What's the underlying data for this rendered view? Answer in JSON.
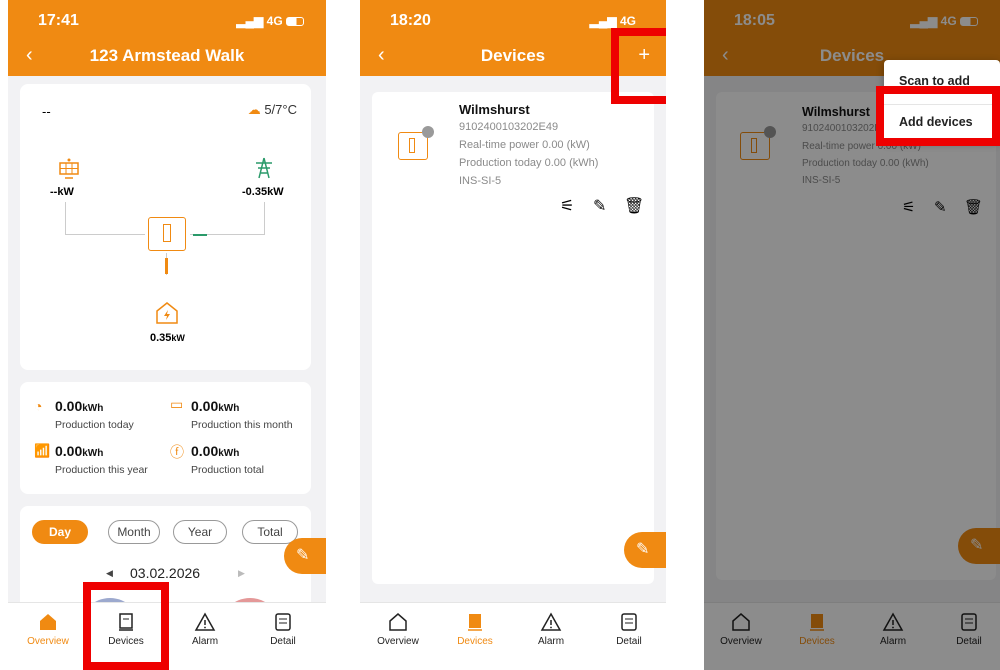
{
  "colors": {
    "accent": "#f08a12",
    "highlight": "#ee0000"
  },
  "screen1": {
    "time": "17:41",
    "signal": "4G",
    "title": "123 Armstead Walk",
    "weather_left": "--",
    "weather_right": "5/7°C",
    "pv_power": "--kW",
    "grid_power": "-0.35kW",
    "home_value": "0.35",
    "home_unit": "kW",
    "stats": [
      {
        "value": "0.00",
        "unit": "kWh",
        "label": "Production today",
        "icon": "gauge-icon"
      },
      {
        "value": "0.00",
        "unit": "kWh",
        "label": "Production this month",
        "icon": "calendar-icon"
      },
      {
        "value": "0.00",
        "unit": "kWh",
        "label": "Production this year",
        "icon": "bar-chart-icon"
      },
      {
        "value": "0.00",
        "unit": "kWh",
        "label": "Production total",
        "icon": "bolt-circle-icon"
      }
    ],
    "period_tabs": [
      "Day",
      "Month",
      "Year",
      "Total"
    ],
    "date": "03.02.2026"
  },
  "screen2": {
    "time": "18:20",
    "signal": "4G",
    "title": "Devices",
    "add": "+",
    "device": {
      "name": "Wilmshurst",
      "serial": "9102400103202E49",
      "realtime": "Real-time power 0.00 (kW)",
      "today": "Production today 0.00 (kWh)",
      "model": "INS-SI-5"
    }
  },
  "screen3": {
    "time": "18:05",
    "signal": "4G",
    "title": "Devices",
    "device": {
      "name": "Wilmshurst",
      "serial": "9102400103202E49",
      "realtime": "Real-time power 0.00 (kW)",
      "today": "Production today 0.00 (kWh)",
      "model": "INS-SI-5"
    },
    "menu": [
      "Scan to add",
      "Add devices"
    ]
  },
  "tabbar": [
    "Overview",
    "Devices",
    "Alarm",
    "Detail"
  ]
}
